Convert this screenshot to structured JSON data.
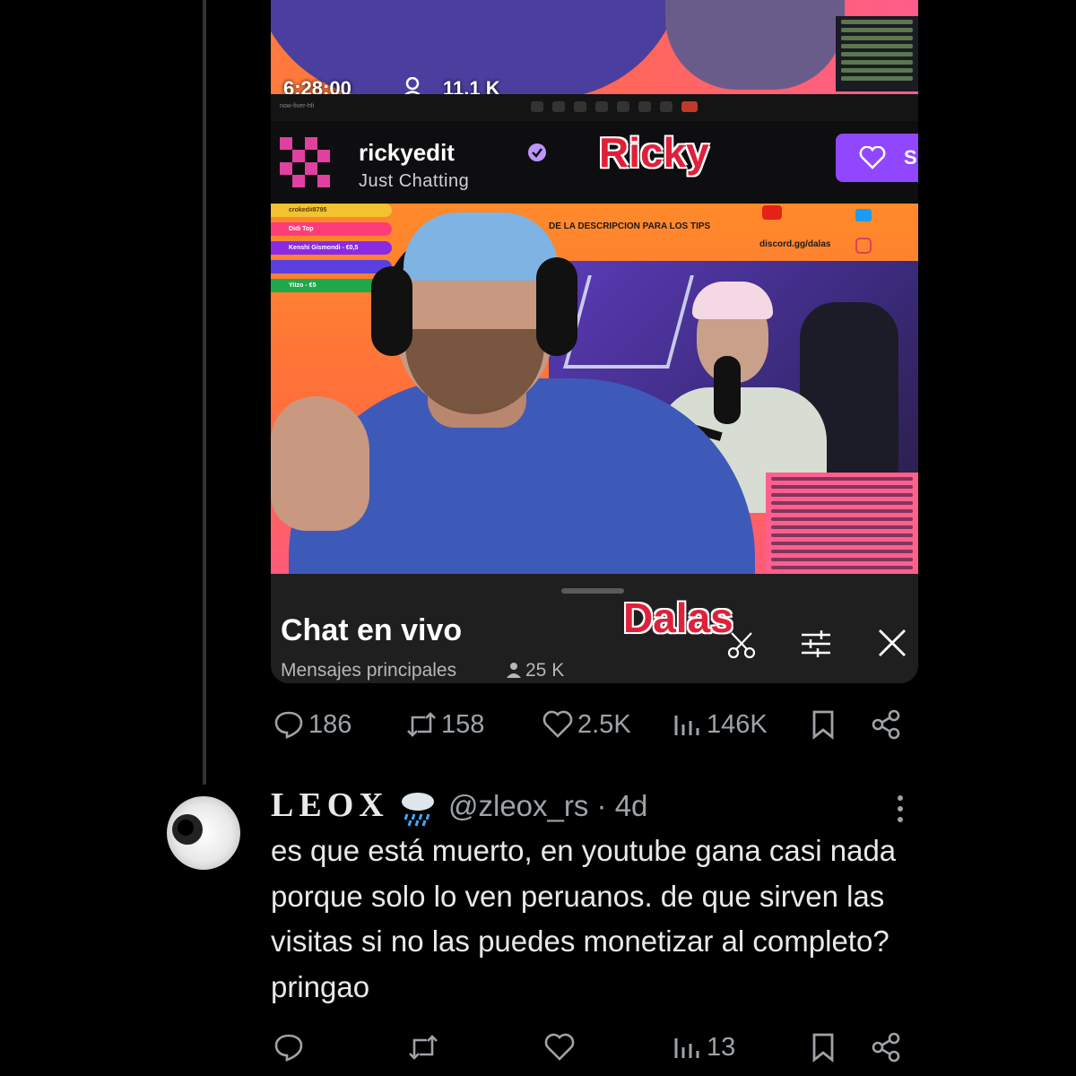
{
  "media": {
    "overlay_time": "6:28:00",
    "overlay_viewers": "11.1 K",
    "toolbar_label": "now-fiver-hfi",
    "channel": {
      "name": "rickyedit",
      "category": "Just Chatting",
      "annotation": "Ricky",
      "subscribe_label": "S"
    },
    "stream": {
      "donors": [
        "croked#8795",
        "Didi Top",
        "Kenshi Gismondi - €0,5",
        "",
        "Yitzo - €5"
      ],
      "promo_text": "DE LA DESCRIPCION PARA LOS TIPS",
      "discord_text": "discord.gg/dalas"
    },
    "chat_panel": {
      "title": "Chat en vivo",
      "subtitle": "Mensajes principales",
      "viewers": "25 K",
      "annotation": "Dalas"
    }
  },
  "tweet_actions": {
    "replies": "186",
    "reposts": "158",
    "likes": "2.5K",
    "views": "146K"
  },
  "reply": {
    "name": "LEOX",
    "handle_time": "@zleox_rs · 4d",
    "text": "es que está muerto, en youtube gana casi nada porque solo lo ven peruanos. de que sirven las visitas si no las puedes monetizar al completo? pringao",
    "actions": {
      "replies": "",
      "reposts": "",
      "likes": "",
      "views": "13"
    }
  },
  "colors": {
    "background": "#000000",
    "text": "#e7e9ea",
    "muted": "#9ea3a8",
    "twitch_purple": "#9147ff",
    "annotation_red": "#e0203a"
  }
}
